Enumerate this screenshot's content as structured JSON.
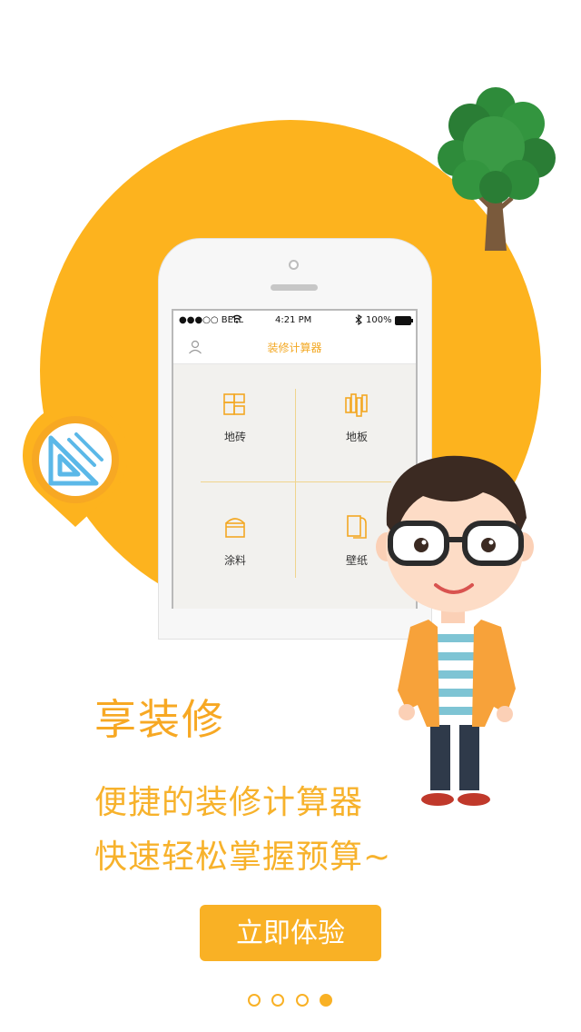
{
  "colors": {
    "accent": "#F9B125",
    "circle": "#FDB31E",
    "pin_icon": "#5BB8E8",
    "tree": "#2E8B3A"
  },
  "phone": {
    "status": {
      "carrier": "●●●○○ BELL",
      "time": "4:21 PM",
      "battery": "100%"
    },
    "nav": {
      "title": "装修计算器",
      "left_icon": "user-icon"
    },
    "grid": [
      {
        "label": "地砖",
        "icon": "tile-icon"
      },
      {
        "label": "地板",
        "icon": "floor-icon"
      },
      {
        "label": "涂料",
        "icon": "paint-icon"
      },
      {
        "label": "壁纸",
        "icon": "wallpaper-icon"
      }
    ]
  },
  "headline": "享装修",
  "subtitle_line1": "便捷的装修计算器",
  "subtitle_line2": "快速轻松掌握预算~",
  "cta_label": "立即体验",
  "pagination": {
    "count": 4,
    "active_index": 3
  }
}
